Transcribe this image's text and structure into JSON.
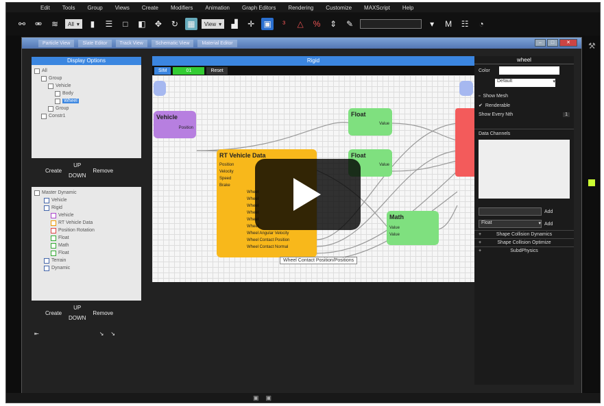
{
  "menu": [
    "Edit",
    "Tools",
    "Group",
    "Views",
    "Create",
    "Modifiers",
    "Animation",
    "Graph Editors",
    "Rendering",
    "Customize",
    "MAXScript",
    "Help"
  ],
  "toolbar": {
    "selection_filter": "All",
    "view_label": "View"
  },
  "window": {
    "tabs": [
      "Particle View",
      "Slate Editor",
      "Track View",
      "Schematic View",
      "Material Editor"
    ]
  },
  "display_options": {
    "title": "Display Options",
    "items": [
      {
        "label": "All",
        "depth": 0
      },
      {
        "label": "Group",
        "depth": 1
      },
      {
        "label": "Vehicle",
        "depth": 2
      },
      {
        "label": "Body",
        "depth": 3
      },
      {
        "label": "Wheel",
        "depth": 3,
        "selected": true
      },
      {
        "label": "Group",
        "depth": 2
      },
      {
        "label": "Constr1",
        "depth": 1
      }
    ]
  },
  "display_buttons": {
    "create": "Create",
    "up": "UP",
    "down": "DOWN",
    "remove": "Remove"
  },
  "master": {
    "items": [
      {
        "label": "Master Dynamic",
        "depth": 0
      },
      {
        "label": "Vehicle",
        "depth": 1
      },
      {
        "label": "Rigid",
        "depth": 1
      },
      {
        "label": "Vehicle",
        "depth": 2
      },
      {
        "label": "RT Vehicle Data",
        "depth": 2
      },
      {
        "label": "Position Rotation",
        "depth": 2
      },
      {
        "label": "Float",
        "depth": 2
      },
      {
        "label": "Math",
        "depth": 2
      },
      {
        "label": "Float",
        "depth": 2
      },
      {
        "label": "Terrain",
        "depth": 1
      },
      {
        "label": "Dynamic",
        "depth": 1
      }
    ]
  },
  "master_buttons": {
    "create": "Create",
    "up": "UP",
    "down": "DOWN",
    "remove": "Remove"
  },
  "graph": {
    "title": "Rigid",
    "bar": [
      "SIM",
      "01",
      "Reset"
    ],
    "nodes": {
      "vehicle": {
        "title": "Vehicle",
        "out": "Position"
      },
      "rt": {
        "title": "RT Vehicle Data",
        "rows": [
          "Position",
          "Velocity",
          "Speed",
          "Brake",
          "Wheel",
          "Wheel",
          "Wheel",
          "Wheel",
          "Wheel",
          "Wheel",
          "Wheel Angular Velocity",
          "Wheel Contact Position",
          "Wheel Contact Normal"
        ]
      },
      "float1": {
        "title": "Float",
        "row": "Value"
      },
      "float2": {
        "title": "Float",
        "row": "Value"
      },
      "math": {
        "title": "Math",
        "rows": [
          "Value",
          "Value"
        ]
      }
    },
    "tooltip": "Wheel Contact Position/Positions"
  },
  "props": {
    "header": "wheel",
    "color_label": "Color",
    "dropdown": "Default",
    "show_mesh": "Show Mesh",
    "renderable": "Renderable",
    "show_every_nth": "Show Every Nth",
    "nth_value": "1",
    "data_channels": "Data Channels",
    "add": "Add",
    "float_select": "Float",
    "add2": "Add",
    "sections": [
      "Shape Collision Dynamics",
      "Shape Collision Optimize",
      "SubdPhysics"
    ]
  },
  "play_overlay": {
    "icon": "play-icon"
  }
}
